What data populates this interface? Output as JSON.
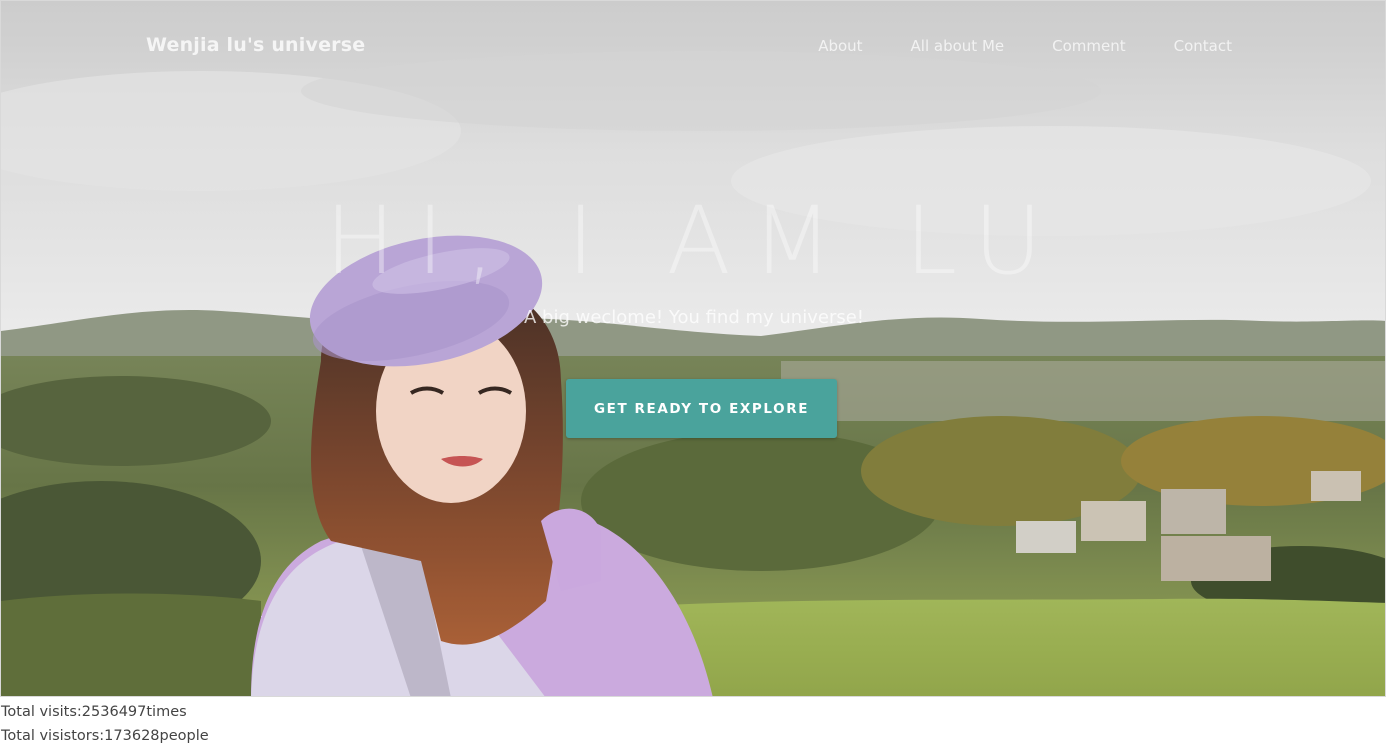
{
  "nav": {
    "brand": "Wenjia lu's universe",
    "items": [
      {
        "label": "About"
      },
      {
        "label": "All about Me"
      },
      {
        "label": "Comment"
      },
      {
        "label": "Contact"
      }
    ]
  },
  "hero": {
    "title": "HI, I AM LU",
    "subtitle": "A big weclome! You find my universe!",
    "button_label": "GET READY TO EXPLORE",
    "accent_color": "#4aa39c"
  },
  "stats": {
    "visits_line": "Total visits:2536497times",
    "visitors_line": "Total visistors:173628people"
  }
}
